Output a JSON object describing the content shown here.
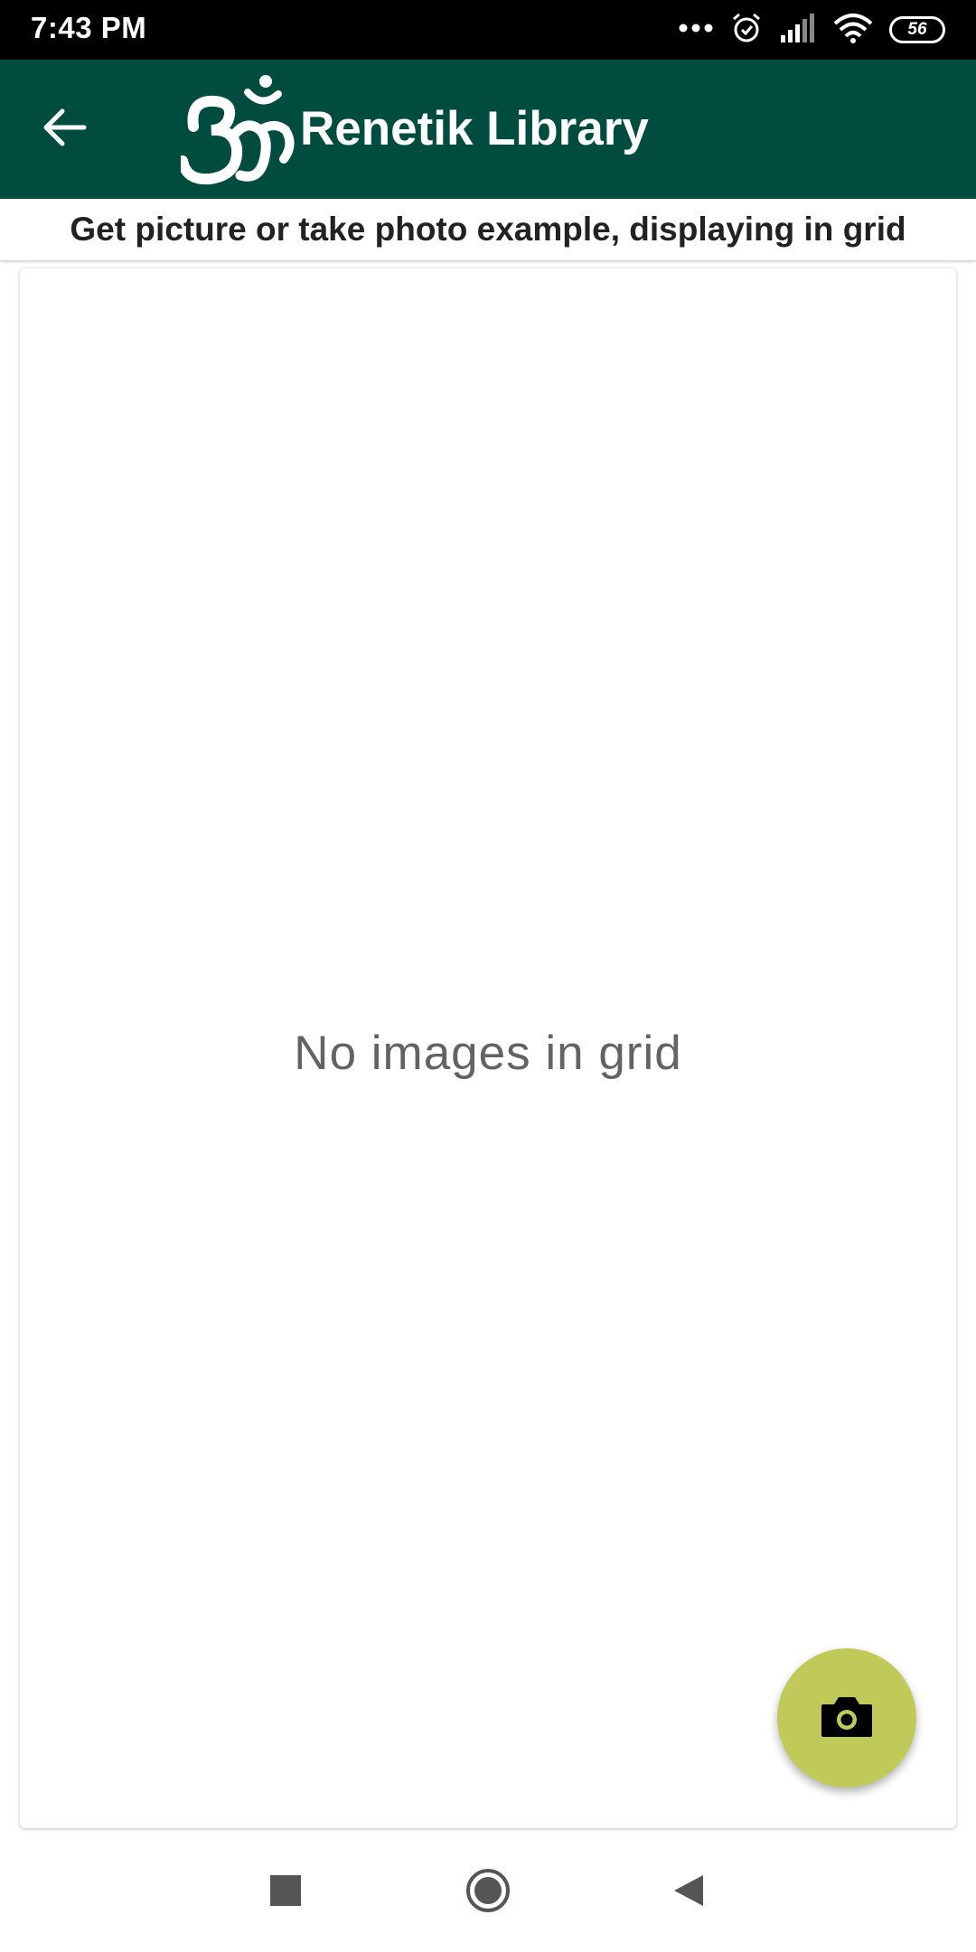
{
  "status_bar": {
    "time": "7:43 PM",
    "battery": "56",
    "icons": [
      "more-dots-icon",
      "alarm-icon",
      "signal-icon",
      "wifi-icon",
      "battery-icon"
    ]
  },
  "app_bar": {
    "title": "Renetik Library",
    "back_icon": "arrow-back-icon",
    "logo_icon": "om-logo-icon",
    "background_color": "#004d40"
  },
  "subheader": {
    "text": "Get picture or take photo example, displaying in grid"
  },
  "grid": {
    "empty_text": "No images in grid"
  },
  "fab": {
    "icon": "camera-icon",
    "color": "#c0ca59"
  },
  "nav_bar": {
    "buttons": [
      "recents-square-icon",
      "home-circle-icon",
      "back-triangle-icon"
    ]
  }
}
